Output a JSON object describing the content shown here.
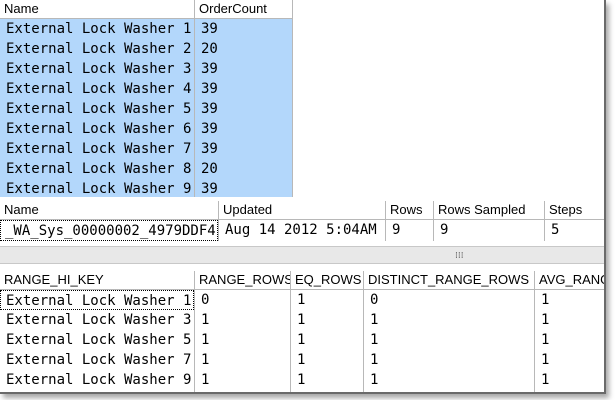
{
  "grid1": {
    "headers": [
      "Name",
      "OrderCount"
    ],
    "rows": [
      [
        "External Lock Washer 1",
        "39"
      ],
      [
        "External Lock Washer 2",
        "20"
      ],
      [
        "External Lock Washer 3",
        "39"
      ],
      [
        "External Lock Washer 4",
        "39"
      ],
      [
        "External Lock Washer 5",
        "39"
      ],
      [
        "External Lock Washer 6",
        "39"
      ],
      [
        "External Lock Washer 7",
        "39"
      ],
      [
        "External Lock Washer 8",
        "20"
      ],
      [
        "External Lock Washer 9",
        "39"
      ]
    ]
  },
  "grid2": {
    "headers": [
      "Name",
      "Updated",
      "Rows",
      "Rows Sampled",
      "Steps"
    ],
    "rows": [
      [
        "_WA_Sys_00000002_4979DDF4",
        "Aug 14 2012  5:04AM",
        "9",
        "9",
        "5"
      ]
    ]
  },
  "grid3": {
    "headers": [
      "RANGE_HI_KEY",
      "RANGE_ROWS",
      "EQ_ROWS",
      "DISTINCT_RANGE_ROWS",
      "AVG_RANGE_ROWS"
    ],
    "rows": [
      [
        "External Lock Washer 1",
        "0",
        "1",
        "0",
        "1"
      ],
      [
        "External Lock Washer 3",
        "1",
        "1",
        "1",
        "1"
      ],
      [
        "External Lock Washer 5",
        "1",
        "1",
        "1",
        "1"
      ],
      [
        "External Lock Washer 7",
        "1",
        "1",
        "1",
        "1"
      ],
      [
        "External Lock Washer 9",
        "1",
        "1",
        "1",
        "1"
      ]
    ]
  },
  "colors": {
    "selection": "#b3d7fb",
    "divider": "#b8b8b8"
  },
  "icons": {
    "splitter": "grip-dots-icon"
  }
}
